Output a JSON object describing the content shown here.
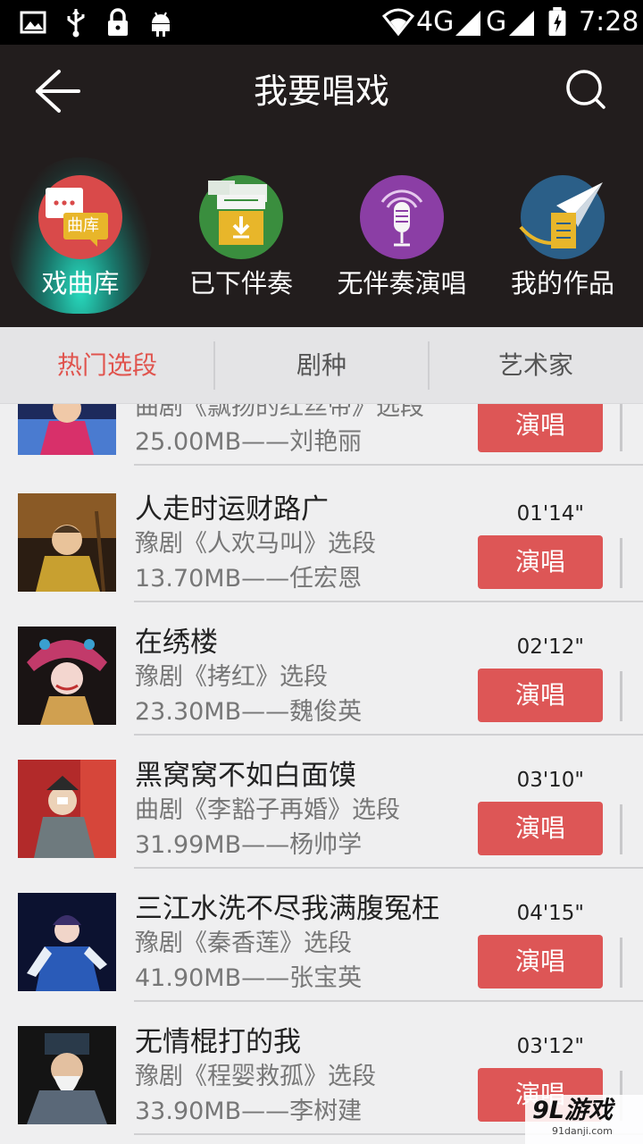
{
  "status_bar": {
    "icons": [
      "image-icon",
      "usb-icon",
      "lock-icon",
      "android-icon",
      "wifi-icon",
      "signal-icon",
      "battery-icon"
    ],
    "network_1": "4G",
    "network_2": "G",
    "time": "7:28"
  },
  "header": {
    "title": "我要唱戏",
    "back_icon": "back-arrow-icon",
    "search_icon": "search-icon"
  },
  "categories": [
    {
      "label": "戏曲库",
      "icon": "opera-library-icon",
      "badge": "曲库",
      "color": "#d94a4a",
      "active": true
    },
    {
      "label": "已下伴奏",
      "icon": "download-icon",
      "color": "#3a8e3e",
      "active": false
    },
    {
      "label": "无伴奏演唱",
      "icon": "microphone-icon",
      "color": "#8b3ea5",
      "active": false
    },
    {
      "label": "我的作品",
      "icon": "paper-plane-icon",
      "color": "#2b5f88",
      "active": false
    }
  ],
  "tabs": [
    {
      "label": "热门选段",
      "active": true
    },
    {
      "label": "剧种",
      "active": false
    },
    {
      "label": "艺术家",
      "active": false
    }
  ],
  "songs": [
    {
      "title": "",
      "duration": "",
      "subtitle": "曲剧《飘扬的红丝带》选段",
      "size_artist": "25.00MB——刘艳丽",
      "action": "演唱"
    },
    {
      "title": "人走时运财路广",
      "duration": "01'14\"",
      "subtitle": "豫剧《人欢马叫》选段",
      "size_artist": "13.70MB——任宏恩",
      "action": "演唱"
    },
    {
      "title": "在绣楼",
      "duration": "02'12\"",
      "subtitle": "豫剧《拷红》选段",
      "size_artist": "23.30MB——魏俊英",
      "action": "演唱"
    },
    {
      "title": "黑窝窝不如白面馍",
      "duration": "03'10\"",
      "subtitle": "曲剧《李豁子再婚》选段",
      "size_artist": "31.99MB——杨帅学",
      "action": "演唱"
    },
    {
      "title": "三江水洗不尽我满腹冤枉",
      "duration": "04'15\"",
      "subtitle": "豫剧《秦香莲》选段",
      "size_artist": "41.90MB——张宝英",
      "action": "演唱"
    },
    {
      "title": "无情棍打的我",
      "duration": "03'12\"",
      "subtitle": "豫剧《程婴救孤》选段",
      "size_artist": "33.90MB——李树建",
      "action": "演唱"
    }
  ],
  "watermark": {
    "main": "9L游戏",
    "sub": "91danji.com"
  },
  "colors": {
    "accent": "#dd5656",
    "header_bg": "#221d1d",
    "tab_active": "#e0544e"
  }
}
